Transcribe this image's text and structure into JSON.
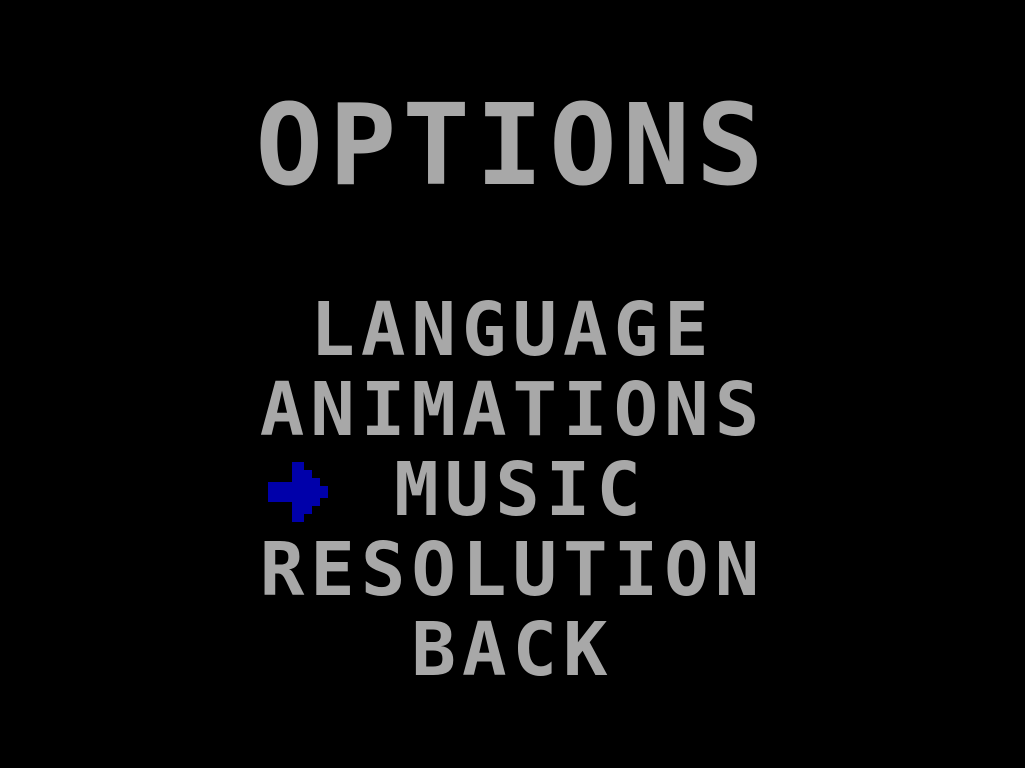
{
  "screen": {
    "title": "OPTIONS",
    "background_color": "#000000",
    "text_color": "#a8a8a8",
    "cursor_color": "#0000aa"
  },
  "menu": {
    "items": [
      {
        "label": "LANGUAGE"
      },
      {
        "label": "ANIMATIONS"
      },
      {
        "label": "MUSIC"
      },
      {
        "label": "RESOLUTION"
      },
      {
        "label": "BACK"
      }
    ],
    "selected_index": 2,
    "cursor_icon": "right-arrow-icon"
  }
}
